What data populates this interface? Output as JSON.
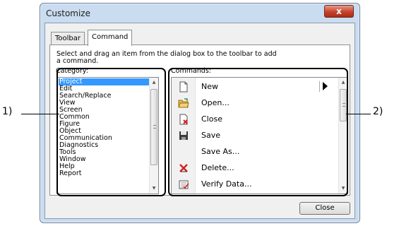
{
  "window": {
    "title": "Customize",
    "close_glyph": "x"
  },
  "tabs": [
    {
      "label": "Toolbar",
      "selected": false
    },
    {
      "label": "Command",
      "selected": true
    }
  ],
  "instructions": "Select and drag an item from the dialog box to the toolbar to add a command.",
  "category": {
    "label": "Category:",
    "items": [
      "Project",
      "Edit",
      "Search/Replace",
      "View",
      "Screen",
      "Common",
      "Figure",
      "Object",
      "Communication",
      "Diagnostics",
      "Tools",
      "Window",
      "Help",
      "Report"
    ],
    "selected": "Project"
  },
  "commands": {
    "label": "Commands:",
    "items": [
      {
        "label": "New",
        "icon": "new-file-icon",
        "has_submenu": true
      },
      {
        "label": "Open...",
        "icon": "open-folder-icon",
        "has_submenu": false
      },
      {
        "label": "Close",
        "icon": "close-file-icon",
        "has_submenu": false
      },
      {
        "label": "Save",
        "icon": "save-icon",
        "has_submenu": false
      },
      {
        "label": "Save As...",
        "icon": "",
        "has_submenu": false
      },
      {
        "label": "Delete...",
        "icon": "delete-icon",
        "has_submenu": false
      },
      {
        "label": "Verify Data...",
        "icon": "verify-data-icon",
        "has_submenu": false
      }
    ]
  },
  "buttons": {
    "close": "Close"
  },
  "callouts": {
    "one": "1)",
    "two": "2)"
  },
  "colors": {
    "selection": "#3399ff",
    "title_close": "#c4432c",
    "frame": "#c9dcf0"
  }
}
